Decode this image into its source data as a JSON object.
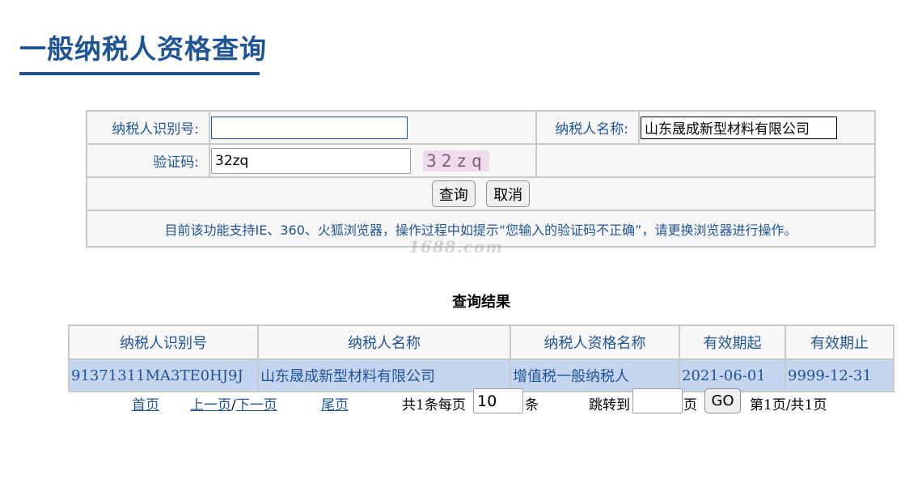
{
  "page": {
    "title": "一般纳税人资格查询"
  },
  "form": {
    "taxpayer_id_label": "纳税人识别号:",
    "taxpayer_id_value": "",
    "taxpayer_name_label": "纳税人名称:",
    "taxpayer_name_value": "山东晟成新型材料有限公司",
    "captcha_label": "验证码:",
    "captcha_value": "32zq",
    "captcha_image_text": "32zq",
    "query_button": "查询",
    "cancel_button": "取消",
    "notice": "目前该功能支持IE、360、火狐浏览器，操作过程中如提示“您输入的验证码不正确”，请更换浏览器进行操作。"
  },
  "watermark": "1688.com",
  "results": {
    "title": "查询结果",
    "columns": [
      "纳税人识别号",
      "纳税人名称",
      "纳税人资格名称",
      "有效期起",
      "有效期止"
    ],
    "rows": [
      [
        "91371311MA3TE0HJ9J",
        "山东晟成新型材料有限公司",
        "增值税一般纳税人",
        "2021-06-01",
        "9999-12-31"
      ]
    ]
  },
  "pager": {
    "first": "首页",
    "prev": "上一页",
    "separator": "/",
    "next": "下一页",
    "last": "尾页",
    "total_prefix": "共1条每页",
    "page_size": "10",
    "page_size_suffix": "条",
    "jump_label": "跳转到",
    "jump_value": "",
    "jump_suffix": "页",
    "go": "GO",
    "status": "第1页/共1页"
  },
  "colors": {
    "brand": "#1f5597",
    "row_highlight": "#c5d5ef"
  }
}
